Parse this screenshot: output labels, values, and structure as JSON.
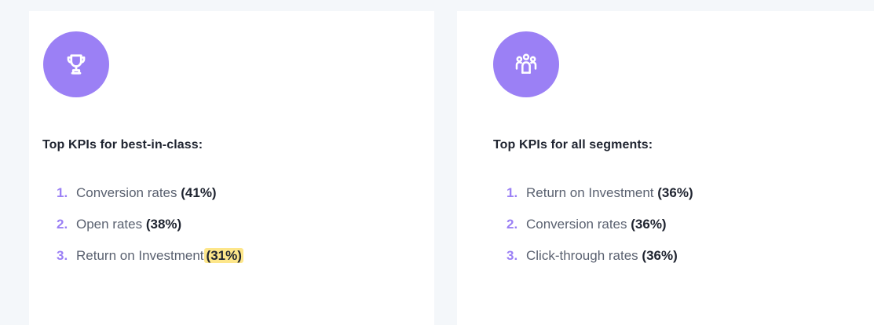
{
  "colors": {
    "accent": "#9b80f5",
    "highlight": "#fde68a",
    "card_bg": "#ffffff",
    "page_bg": "#f4f7fa"
  },
  "cards": [
    {
      "icon": "trophy-icon",
      "title": "Top KPIs for best-in-class:",
      "items": [
        {
          "num": "1.",
          "label": "Conversion rates",
          "pct": "(41%)",
          "highlighted": false
        },
        {
          "num": "2.",
          "label": "Open rates",
          "pct": "(38%)",
          "highlighted": false
        },
        {
          "num": "3.",
          "label": "Return on Investment",
          "pct": "(31%)",
          "highlighted": true
        }
      ]
    },
    {
      "icon": "users-group-icon",
      "title": "Top KPIs for all segments:",
      "items": [
        {
          "num": "1.",
          "label": "Return on Investment",
          "pct": "(36%)",
          "highlighted": false
        },
        {
          "num": "2.",
          "label": "Conversion rates",
          "pct": "(36%)",
          "highlighted": false
        },
        {
          "num": "3.",
          "label": "Click-through rates",
          "pct": "(36%)",
          "highlighted": false
        }
      ]
    }
  ]
}
